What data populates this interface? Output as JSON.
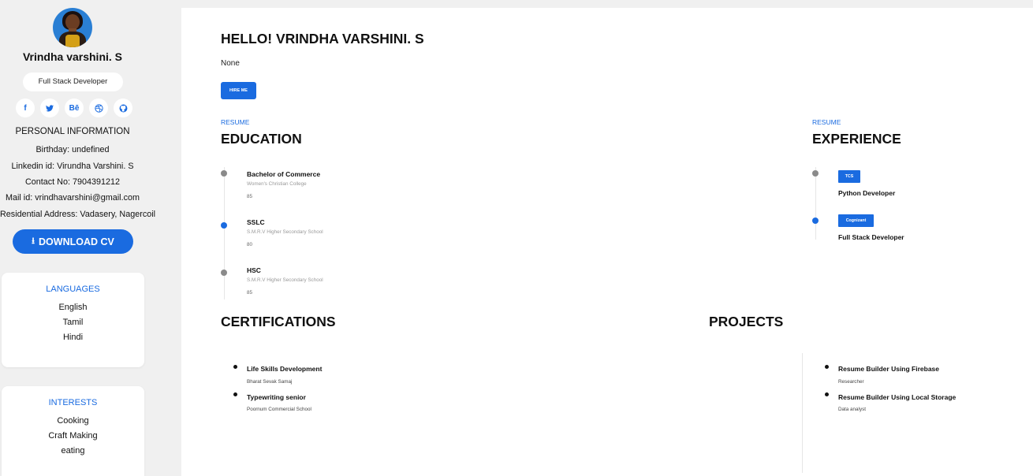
{
  "profile": {
    "name": "Vrindha varshini. S",
    "role": "Full Stack Developer",
    "socials": [
      {
        "icon": "facebook-icon",
        "glyph": "f"
      },
      {
        "icon": "twitter-icon",
        "glyph": "🐦"
      },
      {
        "icon": "behance-icon",
        "glyph": "Bē"
      },
      {
        "icon": "dribbble-icon",
        "glyph": "⊛"
      },
      {
        "icon": "github-icon",
        "glyph": "◉"
      }
    ],
    "personal_info_title": "PERSONAL INFORMATION",
    "personal_info": [
      "Birthday: undefined",
      "Linkedin id: Virundha Varshini. S",
      "Contact No: 7904391212",
      "Mail id: vrindhavarshini@gmail.com",
      "Residential Address: Vadasery, Nagercoil"
    ],
    "download_label": "DOWNLOAD CV",
    "download_icon": "⭳"
  },
  "languages": {
    "title": "LANGUAGES",
    "items": [
      "English",
      "Tamil",
      "Hindi"
    ]
  },
  "interests": {
    "title": "INTERESTS",
    "items": [
      "Cooking",
      "Craft Making",
      "eating"
    ]
  },
  "main": {
    "greeting": "HELLO! VRINDHA VARSHINI. S",
    "summary": "None",
    "hire_label": "HIRE ME"
  },
  "education": {
    "tag": "RESUME",
    "title": "EDUCATION",
    "items": [
      {
        "degree": "Bachelor of Commerce",
        "school": "Women's Christian College",
        "score": "85",
        "dot": "gray"
      },
      {
        "degree": "SSLC",
        "school": "S.M.R.V Higher Secondary School",
        "score": "80",
        "dot": "blue"
      },
      {
        "degree": "HSC",
        "school": "S.M.R.V Higher Secondary School",
        "score": "85",
        "dot": "gray"
      }
    ]
  },
  "experience": {
    "tag": "RESUME",
    "title": "EXPERIENCE",
    "items": [
      {
        "company": "TCS",
        "role": "Python Developer",
        "dot": "gray"
      },
      {
        "company": "Cognizant",
        "role": "Full Stack Developer",
        "dot": "blue"
      }
    ]
  },
  "certifications": {
    "title": "CERTIFICATIONS",
    "items": [
      {
        "name": "Life Skills Development",
        "issuer": "Bharat Sevak Samaj"
      },
      {
        "name": "Typewriting senior",
        "issuer": "Poornum Commercial School"
      }
    ]
  },
  "projects": {
    "title": "PROJECTS",
    "items": [
      {
        "name": "Resume Builder Using Firebase",
        "role": "Researcher"
      },
      {
        "name": "Resume Builder Using Local Storage",
        "role": "Data analyst"
      }
    ]
  },
  "colors": {
    "accent": "#1a6be0",
    "sidebar_bg": "#f0f0f0"
  }
}
